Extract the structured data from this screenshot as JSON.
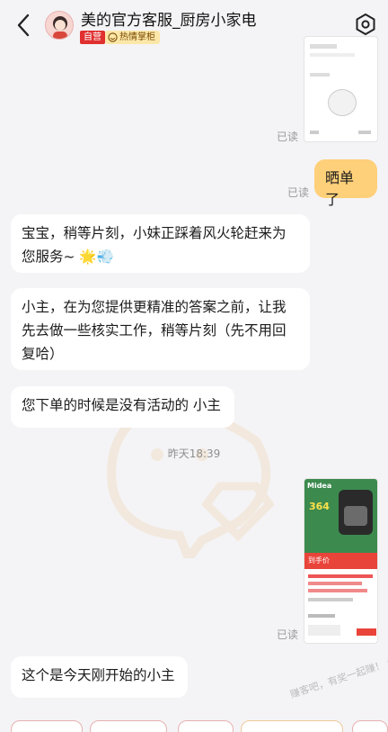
{
  "header": {
    "title": "美的官方客服_厨房小家电",
    "badge_self": "自营",
    "badge_hot": "热情掌柜"
  },
  "messages": {
    "read_label": "已读",
    "sent_text": "晒单了",
    "reply_1": "宝宝，稍等片刻，小妹正踩着风火轮赶来为您服务~ 🌟💨",
    "reply_2": "小主，在为您提供更精准的答案之前，让我先去做一些核实工作，稍等片刻（先不用回复哈）",
    "reply_3": "您下单的时候是没有活动的 小主",
    "timestamp": "昨天18:39",
    "reply_4": "这个是今天刚开始的小主"
  },
  "product_image": {
    "brand": "Midea",
    "price": "364",
    "banner": "到手价"
  },
  "watermark_text": "赚客吧，有奖一起赚！ www.zuanke8.com",
  "colors": {
    "background": "#f4f4f6",
    "sent_bubble": "#ffd07a",
    "received_bubble": "#ffffff",
    "badge_self": "#e0302f",
    "badge_hot": "#fce7a8"
  }
}
